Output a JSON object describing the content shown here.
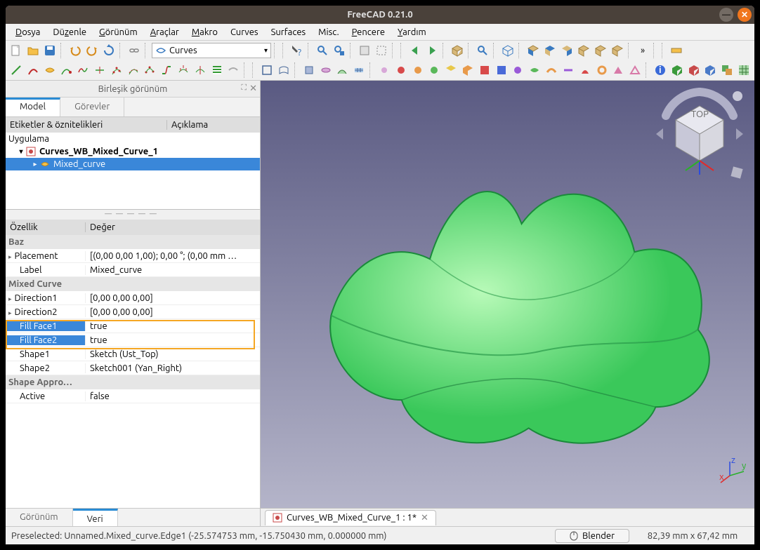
{
  "window": {
    "title": "FreeCAD 0.21.0"
  },
  "menu": {
    "items": [
      "Dosya",
      "Düzenle",
      "Görünüm",
      "Araçlar",
      "Makro",
      "Curves",
      "Surfaces",
      "Misc.",
      "Pencere",
      "Yardım"
    ]
  },
  "workbench": {
    "selected": "Curves"
  },
  "panel": {
    "title": "Birleşik görünüm",
    "tabs": {
      "model": "Model",
      "tasks": "Görevler"
    },
    "tree_cols": {
      "labels": "Etiketler & öznitelikleri",
      "desc": "Açıklama"
    },
    "tree": {
      "app": "Uygulama",
      "doc": "Curves_WB_Mixed_Curve_1",
      "item": "Mixed_curve"
    },
    "prop_cols": {
      "prop": "Özellik",
      "val": "Değer"
    },
    "groups": {
      "base": "Baz",
      "mixed": "Mixed Curve",
      "shape": "Shape Appro…"
    },
    "props": {
      "placement": {
        "name": "Placement",
        "value": "[(0,00 0,00 1,00); 0,00 °; (0,00 mm  …"
      },
      "label": {
        "name": "Label",
        "value": "Mixed_curve"
      },
      "dir1": {
        "name": "Direction1",
        "value": "[0,00 0,00 0,00]"
      },
      "dir2": {
        "name": "Direction2",
        "value": "[0,00 0,00 0,00]"
      },
      "ff1": {
        "name": "Fill Face1",
        "value": "true"
      },
      "ff2": {
        "name": "Fill Face2",
        "value": "true"
      },
      "sh1": {
        "name": "Shape1",
        "value": "Sketch (Ust_Top)"
      },
      "sh2": {
        "name": "Shape2",
        "value": "Sketch001 (Yan_Right)"
      },
      "active": {
        "name": "Active",
        "value": "false"
      }
    },
    "bottom_tabs": {
      "view": "Görünüm",
      "data": "Veri"
    }
  },
  "doc_tab": {
    "label": "Curves_WB_Mixed_Curve_1 : 1*"
  },
  "status": {
    "preselect": "Preselected: Unnamed.Mixed_curve.Edge1 (-25.574753 mm, -15.750430 mm, 0.000000 mm)",
    "nav_style": "Blender",
    "dims": "82,39 mm x 67,42 mm"
  },
  "icons": {
    "toolbar1": [
      "file-new",
      "file-open",
      "file-save",
      "sep",
      "undo",
      "redo",
      "refresh",
      "sep",
      "link",
      "sep",
      "wb",
      "sep",
      "sep",
      "whatsthis",
      "sep",
      "view-fit",
      "sep",
      "draw-style",
      "sep",
      "sep",
      "nav-back",
      "nav-fwd",
      "sep",
      "iso",
      "sep",
      "zoom",
      "sep",
      "cube",
      "sep",
      "iso1",
      "iso2",
      "iso3",
      "iso4",
      "iso5",
      "iso6",
      "sep",
      "more",
      "sep",
      "sep",
      "measure"
    ],
    "toolbar2": [
      "c1",
      "c2",
      "c3",
      "c4",
      "c5",
      "c6",
      "c7",
      "c8",
      "c9",
      "c10",
      "c11",
      "c12",
      "c13",
      "c14",
      "sep",
      "s1",
      "s2",
      "sep",
      "s3",
      "s4",
      "s5",
      "s6",
      "sep",
      "m1",
      "m2",
      "m3",
      "m4",
      "m5",
      "m6",
      "m7",
      "m8",
      "m9",
      "m10",
      "m11",
      "m12",
      "m13",
      "m14",
      "m15",
      "m16",
      "m17",
      "sep",
      "b1",
      "b2",
      "b3",
      "b4",
      "b5",
      "b6"
    ]
  }
}
